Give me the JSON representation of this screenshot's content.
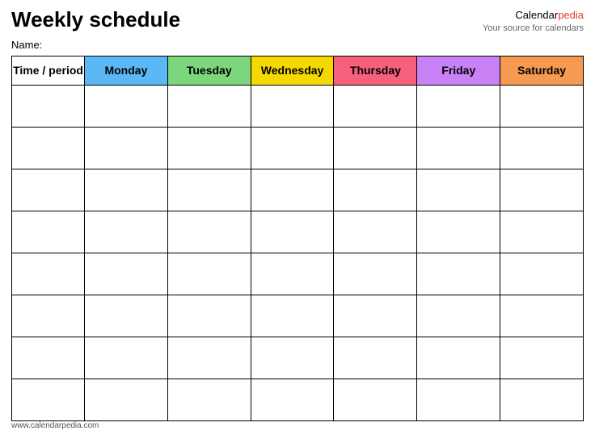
{
  "header": {
    "title": "Weekly schedule",
    "brand_name": "Calendar",
    "brand_name_suffix": "pedia",
    "brand_tagline": "Your source for calendars",
    "brand_url": "www.calendarpedia.com"
  },
  "name_label": "Name:",
  "columns": {
    "time_period": "Time / period",
    "monday": "Monday",
    "tuesday": "Tuesday",
    "wednesday": "Wednesday",
    "thursday": "Thursday",
    "friday": "Friday",
    "saturday": "Saturday"
  },
  "colors": {
    "monday": "#5bb8f5",
    "tuesday": "#7cd67c",
    "wednesday": "#f5d800",
    "thursday": "#f5607a",
    "friday": "#c882f5",
    "saturday": "#f59a50"
  },
  "footer_url": "www.calendarpedia.com",
  "row_count": 8
}
